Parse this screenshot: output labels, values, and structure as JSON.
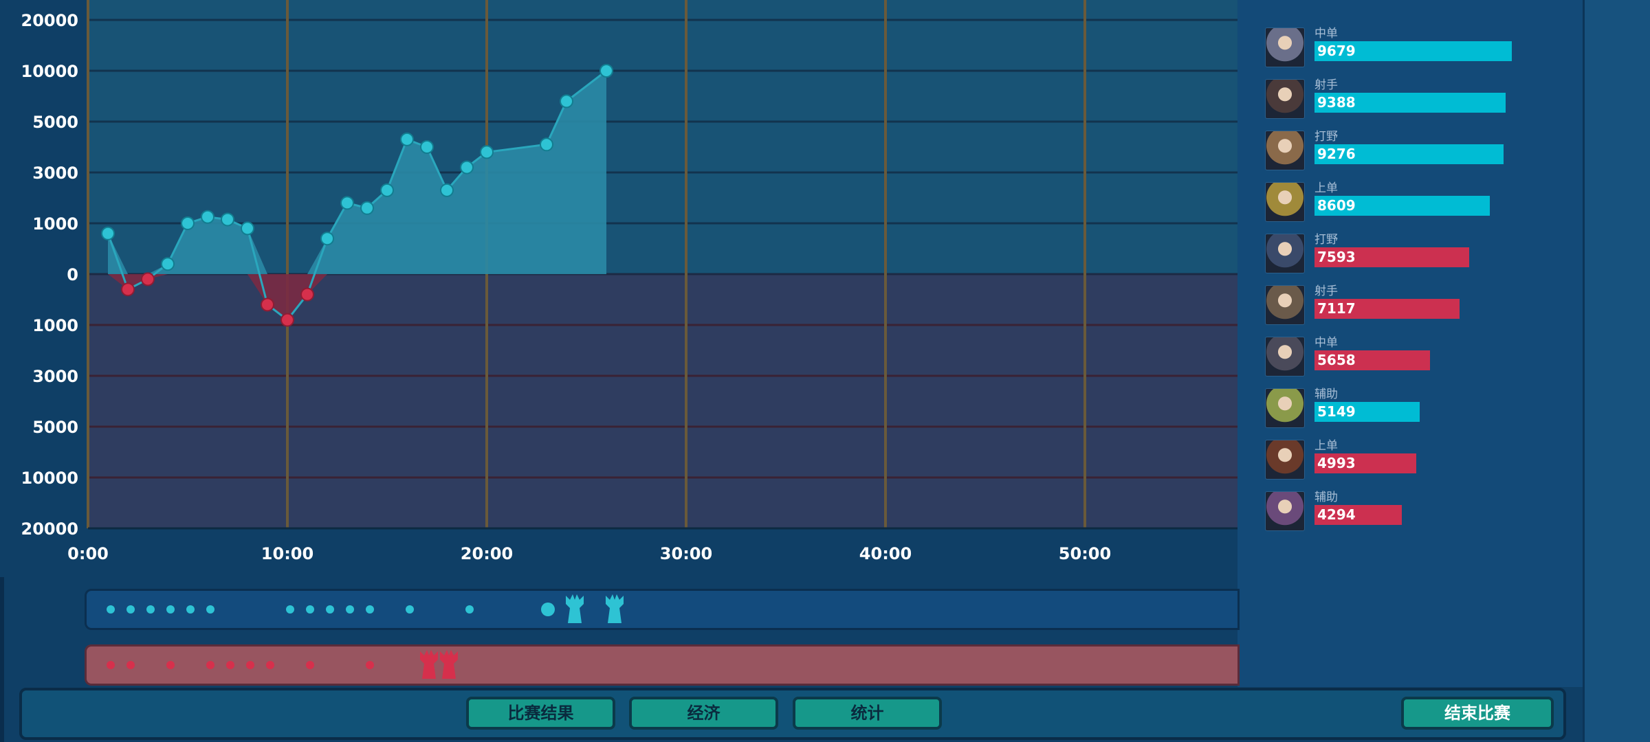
{
  "chart_data": {
    "type": "area",
    "y_ticks": [
      "20000",
      "10000",
      "5000",
      "3000",
      "1000",
      "0",
      "1000",
      "3000",
      "5000",
      "10000",
      "20000"
    ],
    "x_ticks": [
      "0:00",
      "10:00",
      "20:00",
      "30:00",
      "40:00",
      "50:00"
    ],
    "x_minutes": [
      1,
      2,
      3,
      4,
      5,
      6,
      7,
      8,
      9,
      10,
      11,
      12,
      13,
      14,
      15,
      16,
      17,
      18,
      19,
      20,
      23,
      24,
      26
    ],
    "y_values": [
      800,
      -300,
      -100,
      200,
      1000,
      1250,
      1150,
      900,
      -600,
      -900,
      -400,
      700,
      1800,
      1600,
      2300,
      4300,
      4000,
      2300,
      3200,
      3800,
      4100,
      7000,
      10000
    ],
    "positive_color": "#2ec3d4",
    "negative_color": "#d6304c",
    "grid": true
  },
  "side_panel": {
    "heroes": [
      {
        "role": "中单",
        "value": "9679",
        "team": "blue",
        "portrait": "silver-armored-hero-portrait"
      },
      {
        "role": "射手",
        "value": "9388",
        "team": "blue",
        "portrait": "dark-haired-archer-portrait"
      },
      {
        "role": "打野",
        "value": "9276",
        "team": "blue",
        "portrait": "white-haired-hero-portrait"
      },
      {
        "role": "上单",
        "value": "8609",
        "team": "blue",
        "portrait": "golden-armored-hero-portrait"
      },
      {
        "role": "打野",
        "value": "7593",
        "team": "red",
        "portrait": "masked-hero-portrait"
      },
      {
        "role": "射手",
        "value": "7117",
        "team": "red",
        "portrait": "hat-wearing-hero-portrait"
      },
      {
        "role": "中单",
        "value": "5658",
        "team": "red",
        "portrait": "straw-hat-hero-portrait"
      },
      {
        "role": "辅助",
        "value": "5149",
        "team": "blue",
        "portrait": "horned-helmet-hero-portrait"
      },
      {
        "role": "上单",
        "value": "4993",
        "team": "red",
        "portrait": "bearded-warrior-portrait"
      },
      {
        "role": "辅助",
        "value": "4294",
        "team": "red",
        "portrait": "purple-haired-hero-portrait"
      }
    ],
    "blue_color": "#00bcd4",
    "red_color": "#cc3050"
  },
  "timeline": {
    "blue_events_minutes": [
      1,
      2,
      3,
      4,
      5,
      6,
      10,
      11,
      12,
      13,
      14,
      16,
      19
    ],
    "blue_big_event_minute": 23,
    "blue_tower_minutes": [
      24,
      26
    ],
    "red_events_minutes": [
      1,
      2,
      4,
      6,
      7,
      8,
      9,
      11,
      14
    ],
    "red_tower_minutes": [
      17,
      18
    ]
  },
  "bottom_bar": {
    "tabs": [
      "比赛结果",
      "经济",
      "统计"
    ],
    "end_button": "结束比赛"
  }
}
